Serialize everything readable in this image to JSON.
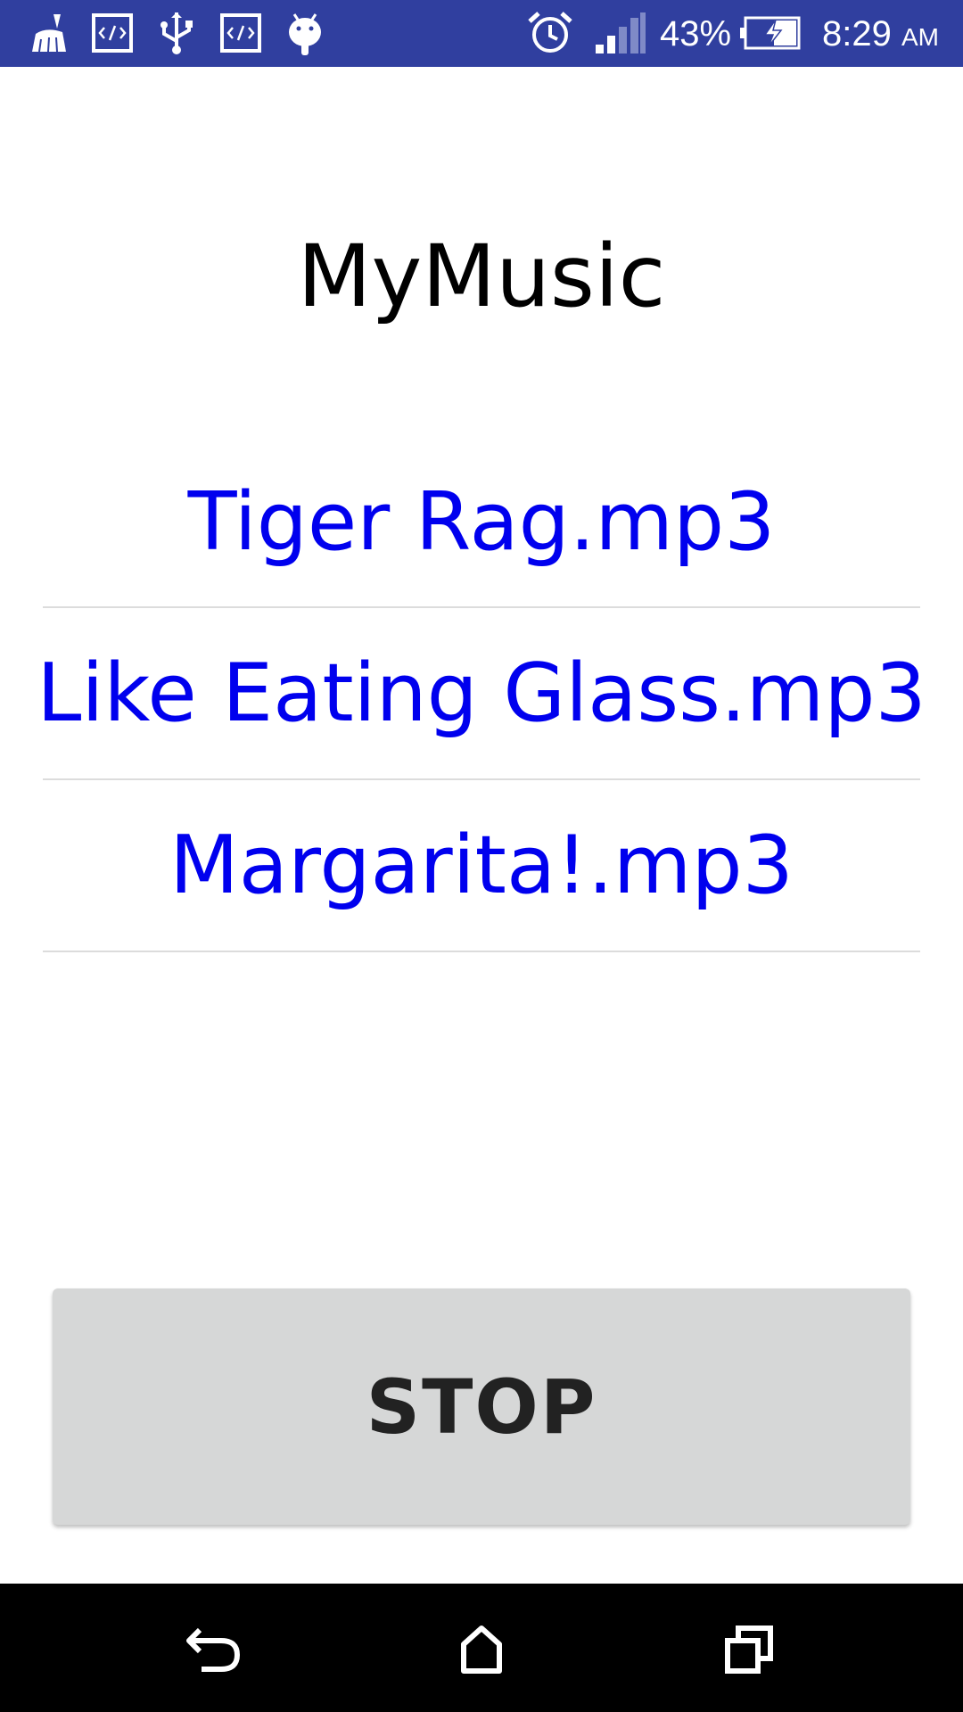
{
  "status_bar": {
    "left_icons": [
      "cleaner-icon",
      "code-icon",
      "usb-icon",
      "code-icon",
      "android-icon"
    ],
    "right_icons": [
      "alarm-icon",
      "signal-icon",
      "battery-charging-icon"
    ],
    "battery_percent": "43%",
    "time": "8:29",
    "ampm": "AM"
  },
  "app": {
    "title": "MyMusic",
    "songs": [
      {
        "label": "Tiger Rag.mp3"
      },
      {
        "label": "Like Eating Glass.mp3"
      },
      {
        "label": "Margarita!.mp3"
      }
    ],
    "stop_label": "STOP"
  },
  "nav_bar": {
    "buttons": [
      "back-icon",
      "home-icon",
      "recents-icon"
    ]
  },
  "colors": {
    "status_bar": "#303f9f",
    "song_text": "#0000ee",
    "button_bg": "#d6d7d7"
  }
}
